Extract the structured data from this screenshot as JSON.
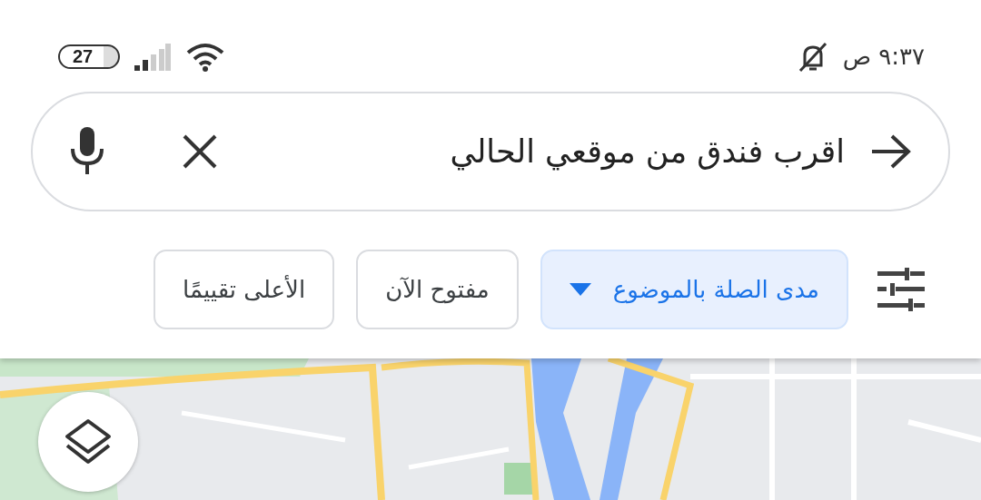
{
  "status_bar": {
    "battery": "27",
    "time": "٩:٣٧ ص"
  },
  "search": {
    "value": "اقرب فندق من موقعي الحالي"
  },
  "chips": [
    {
      "label": "مدى الصلة بالموضوع",
      "selected": true,
      "kind": "dropdown"
    },
    {
      "label": "مفتوح الآن",
      "selected": false,
      "kind": "plain"
    },
    {
      "label": "الأعلى تقييمًا",
      "selected": false,
      "kind": "plain"
    }
  ]
}
